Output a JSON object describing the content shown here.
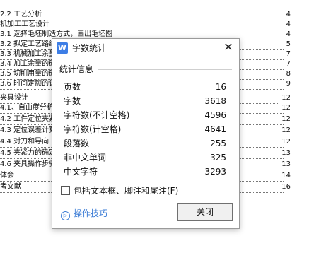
{
  "document": {
    "toc": [
      {
        "text": "2.2 工艺分析",
        "page": "4"
      },
      {
        "text": "机加工工艺设计",
        "page": "4"
      },
      {
        "text": "3.1 选择毛坯制造方式，画出毛坯图",
        "page": "4"
      },
      {
        "text": "3.2 拟定工艺路线",
        "page": "5"
      },
      {
        "text": "3.3 机械加工余量",
        "page": "7"
      },
      {
        "text": "3.4 加工余量的确定",
        "page": "7"
      },
      {
        "text": "3.5 切削用量的确定",
        "page": "8"
      },
      {
        "text": "3.6 时间定额的计算",
        "page": "9"
      },
      {
        "text": "夹具设计",
        "page": "12"
      },
      {
        "text": "4.1、自由度分析",
        "page": "12"
      },
      {
        "text": "4.2 工件定位夹紧",
        "page": "12"
      },
      {
        "text": "4.3 定位误差计算",
        "page": "12"
      },
      {
        "text": "4.4 对刀和导向",
        "page": "12"
      },
      {
        "text": "4.5 夹紧力的确定",
        "page": "13"
      },
      {
        "text": "4.6 夹具操作步骤",
        "page": "13"
      },
      {
        "text": "体会",
        "page": "14"
      },
      {
        "text": "考文献",
        "page": "16"
      }
    ]
  },
  "dialog": {
    "app_icon": "W",
    "title": "字数统计",
    "close_glyph": "✕",
    "section_title": "统计信息",
    "stats": [
      {
        "label": "页数",
        "value": "16"
      },
      {
        "label": "字数",
        "value": "3618"
      },
      {
        "label": "字符数(不计空格)",
        "value": "4596"
      },
      {
        "label": "字符数(计空格)",
        "value": "4641"
      },
      {
        "label": "段落数",
        "value": "255"
      },
      {
        "label": "非中文单词",
        "value": "325"
      },
      {
        "label": "中文字符",
        "value": "3293"
      }
    ],
    "checkbox_label": "包括文本框、脚注和尾注(F)",
    "tips_icon": "▷",
    "tips_label": "操作技巧",
    "close_button": "关闭"
  }
}
